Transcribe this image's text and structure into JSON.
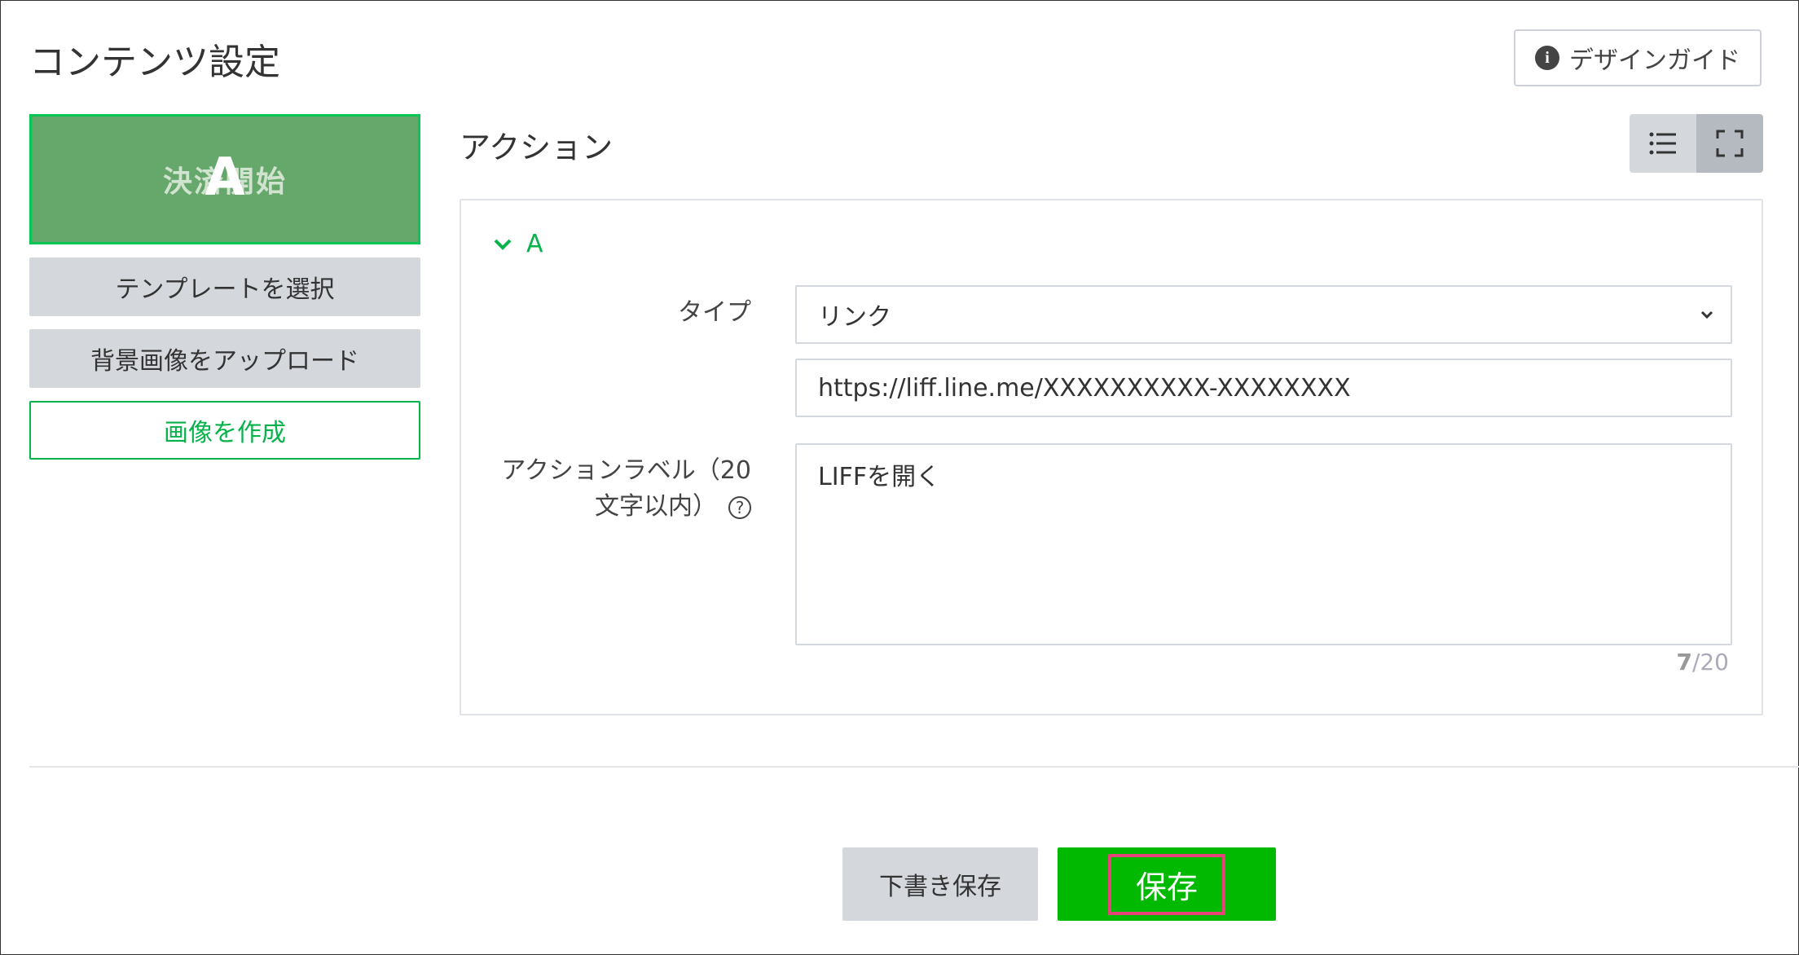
{
  "page": {
    "title": "コンテンツ設定",
    "design_guide_label": "デザインガイド"
  },
  "sidebar": {
    "preview_text": "決済開始",
    "preview_area_letter": "A",
    "template_button": "テンプレートを選択",
    "upload_button": "背景画像をアップロード",
    "create_image_button": "画像を作成"
  },
  "action_section": {
    "title": "アクション",
    "area": {
      "label": "A",
      "expanded": true,
      "type_label": "タイプ",
      "type_value": "リンク",
      "url_value": "https://liff.line.me/XXXXXXXXXX-XXXXXXXX",
      "action_label_title": "アクションラベル（20文字以内）",
      "action_label_line1": "アクションラベル（20",
      "action_label_line2": "文字以内）",
      "help_icon": "?",
      "action_label_value": "LIFFを開く",
      "char_count": "7",
      "char_max": "/20"
    }
  },
  "footer": {
    "draft_button": "下書き保存",
    "save_button": "保存"
  },
  "icons": {
    "info": "info-icon",
    "list_view": "list-icon",
    "fullscreen": "fullscreen-icon",
    "chevron": "chevron-down-icon",
    "help": "question-icon"
  },
  "colors": {
    "accent_green": "#06b24a",
    "save_green": "#00b900",
    "preview_bg": "#66a76b",
    "highlight": "#e8427a"
  }
}
